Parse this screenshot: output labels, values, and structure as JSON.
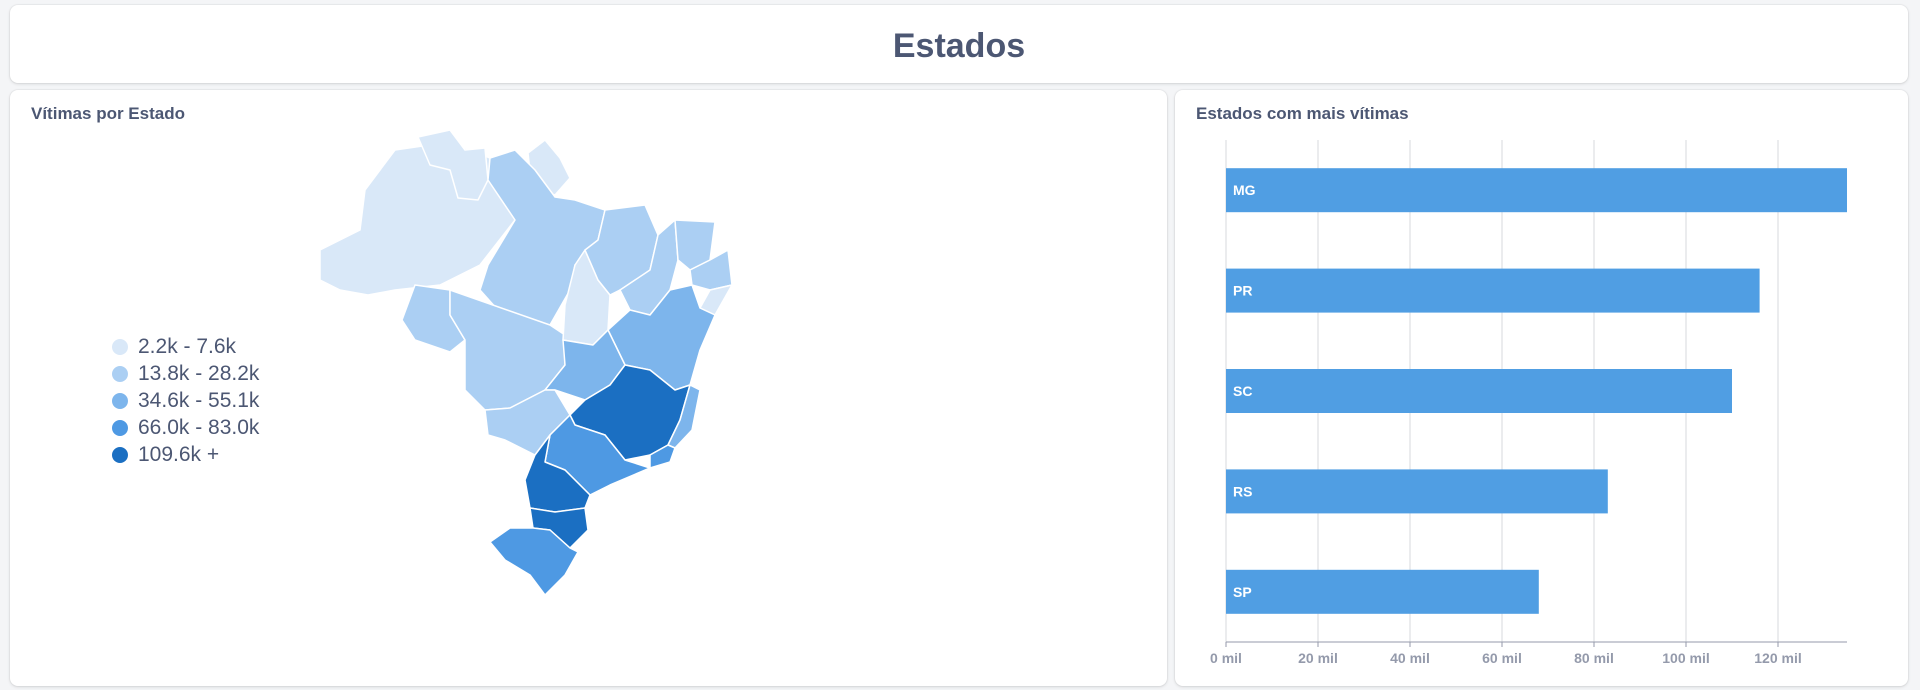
{
  "page": {
    "title": "Estados"
  },
  "map_card": {
    "title": "Vítimas por Estado",
    "legend": [
      {
        "label": "2.2k - 7.6k",
        "color": "#d9e8f8"
      },
      {
        "label": "13.8k - 28.2k",
        "color": "#abcff3"
      },
      {
        "label": "34.6k - 55.1k",
        "color": "#7db5ec"
      },
      {
        "label": "66.0k - 83.0k",
        "color": "#4e99e3"
      },
      {
        "label": "109.6k +",
        "color": "#1b6fc2"
      }
    ]
  },
  "bar_card": {
    "title": "Estados com mais vítimas"
  },
  "chart_data": [
    {
      "type": "bar",
      "orientation": "horizontal",
      "title": "Estados com mais vítimas",
      "categories": [
        "MG",
        "PR",
        "SC",
        "RS",
        "SP"
      ],
      "values": [
        135,
        116,
        110,
        83,
        68
      ],
      "unit": "mil",
      "xlim": [
        0,
        135
      ],
      "x_ticks": [
        0,
        20,
        40,
        60,
        80,
        100,
        120
      ],
      "x_tick_labels": [
        "0 mil",
        "20 mil",
        "40 mil",
        "60 mil",
        "80 mil",
        "100 mil",
        "120 mil"
      ],
      "bar_color": "#509ee3",
      "grid": true
    }
  ]
}
